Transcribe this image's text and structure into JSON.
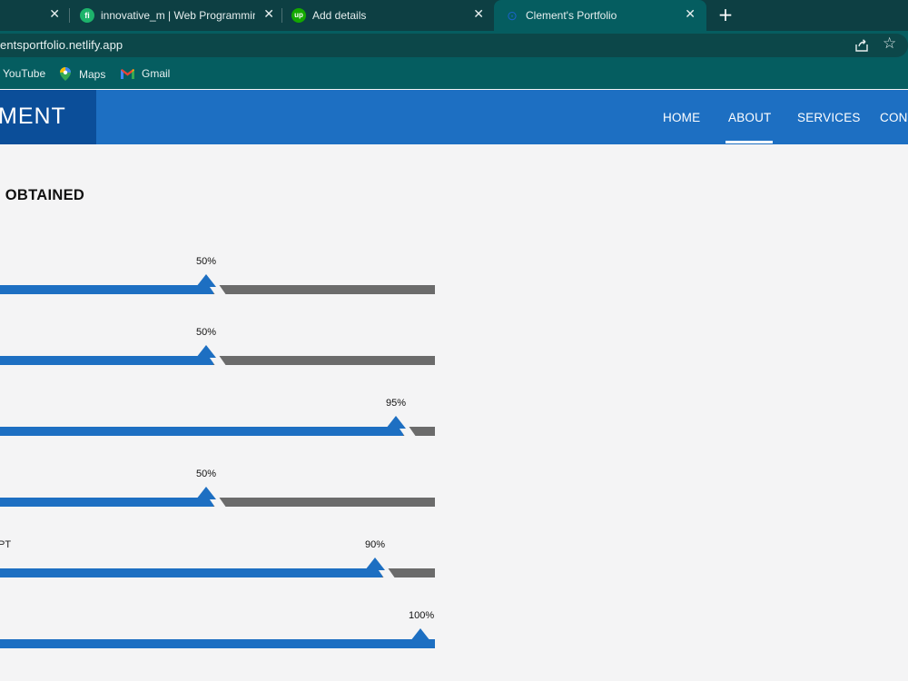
{
  "browser": {
    "tabs": [
      {
        "label": "",
        "active": false
      },
      {
        "label": "innovative_m | Web Programming",
        "active": false,
        "icon_color": "#1db36b",
        "icon_glyph": "fi"
      },
      {
        "label": "Add details",
        "active": false,
        "icon_color": "#14a800",
        "icon_glyph": "up"
      },
      {
        "label": "Clement's Portfolio",
        "active": true,
        "icon_color": "#1b64c8",
        "icon_glyph": "⊙"
      }
    ],
    "close_glyph": "✕",
    "new_tab_glyph": "+",
    "url": "entsportfolio.netlify.app",
    "bookmarks": [
      {
        "label": "YouTube"
      },
      {
        "label": "Maps",
        "icon": "maps-pin-icon"
      },
      {
        "label": "Gmail",
        "icon": "gmail-icon"
      }
    ]
  },
  "site": {
    "logo": "MENT",
    "nav": [
      {
        "label": "HOME"
      },
      {
        "label": "ABOUT",
        "active": true
      },
      {
        "label": "SERVICES"
      },
      {
        "label": "CONT"
      }
    ],
    "section_title": "I OBTAINED",
    "accent_color": "#1d6fc2",
    "track_color": "#6b6b6b"
  },
  "skills": [
    {
      "name": "",
      "percent": 50,
      "label": "50%"
    },
    {
      "name": "",
      "percent": 50,
      "label": "50%"
    },
    {
      "name": "",
      "percent": 95,
      "label": "95%"
    },
    {
      "name": "",
      "percent": 50,
      "label": "50%"
    },
    {
      "name": "PT",
      "percent": 90,
      "label": "90%"
    },
    {
      "name": "",
      "percent": 100,
      "label": "100%"
    }
  ]
}
